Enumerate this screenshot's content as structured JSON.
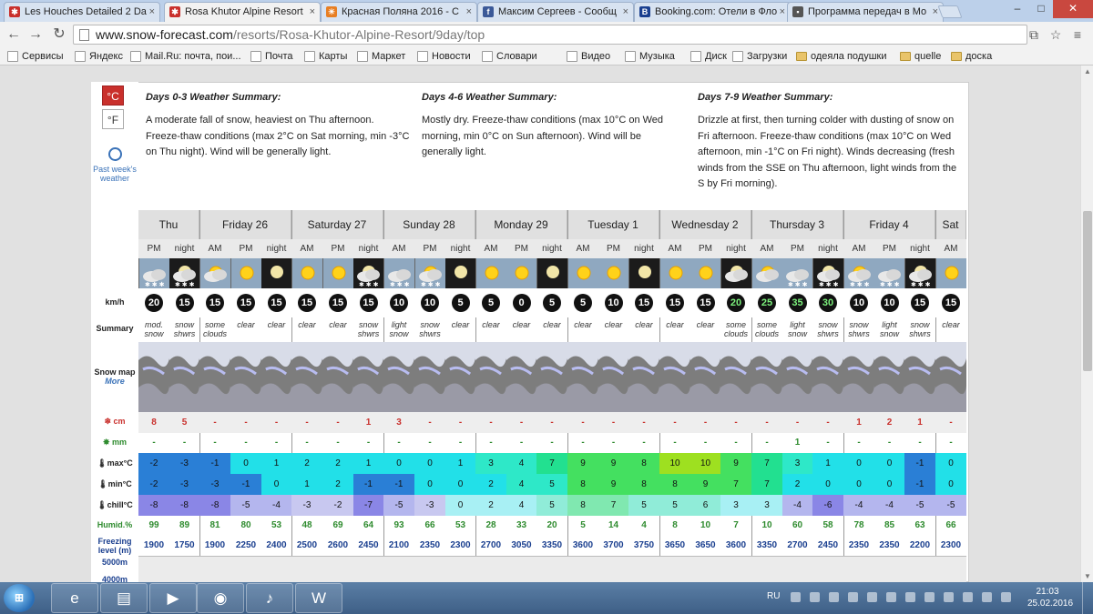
{
  "browser": {
    "tabs": [
      {
        "title": "Les Houches Detailed 2 Da",
        "fav_color": "#c9302c",
        "fav_glyph": "✱"
      },
      {
        "title": "Rosa Khutor Alpine Resort",
        "fav_color": "#c9302c",
        "fav_glyph": "✱"
      },
      {
        "title": "Красная Поляна 2016 - С",
        "fav_color": "#e87e22",
        "fav_glyph": "☀"
      },
      {
        "title": "Максим Сергеев - Сообщ",
        "fav_color": "#3b5998",
        "fav_glyph": "f"
      },
      {
        "title": "Booking.com: Отели в Фло",
        "fav_color": "#1a3f8f",
        "fav_glyph": "B"
      },
      {
        "title": "Программа передач в Мо",
        "fav_color": "#555555",
        "fav_glyph": "▪"
      }
    ],
    "url_host": "www.snow-forecast.com",
    "url_path": "/resorts/Rosa-Khutor-Alpine-Resort/9day/top",
    "bookmarks": [
      {
        "label": "Сервисы",
        "icon": "apps-icon"
      },
      {
        "label": "Яндекс",
        "icon": "page-icon"
      },
      {
        "label": "Mail.Ru: почта, пои...",
        "icon": "mail-icon"
      },
      {
        "label": "Почта",
        "icon": "mail-icon"
      },
      {
        "label": "Карты",
        "icon": "page-icon"
      },
      {
        "label": "Маркет",
        "icon": "page-icon"
      },
      {
        "label": "Новости",
        "icon": "page-icon"
      },
      {
        "label": "Словари",
        "icon": "page-icon"
      },
      {
        "label": "Видео",
        "icon": "page-icon"
      },
      {
        "label": "Музыка",
        "icon": "page-icon"
      },
      {
        "label": "Диск",
        "icon": "page-icon"
      },
      {
        "label": "Загрузки",
        "icon": "download-icon"
      },
      {
        "label": "одеяла подушки",
        "icon": "folder-icon"
      },
      {
        "label": "quelle",
        "icon": "folder-icon"
      },
      {
        "label": "доска",
        "icon": "folder-icon"
      }
    ]
  },
  "units": {
    "celsius": "°C",
    "fahrenheit": "°F"
  },
  "past_weather": "Past week's weather",
  "summaries": [
    {
      "title": "Days 0-3 Weather Summary:",
      "text": "A moderate fall of snow, heaviest on Thu afternoon. Freeze-thaw conditions (max 2°C on Sat morning, min -3°C on Thu night). Wind will be generally light."
    },
    {
      "title": "Days 4-6 Weather Summary:",
      "text": "Mostly dry. Freeze-thaw conditions (max 10°C on Wed morning, min 0°C on Sun afternoon). Wind will be generally light."
    },
    {
      "title": "Days 7-9 Weather Summary:",
      "text": "Drizzle at first, then turning colder with dusting of snow on Fri afternoon. Freeze-thaw conditions (max 10°C on Wed afternoon, min -1°C on Fri night). Winds decreasing (fresh winds from the SSE on Thu afternoon, light winds from the S by Fri morning)."
    }
  ],
  "row_labels": {
    "wind": "km/h",
    "summary": "Summary",
    "snowmap": "Snow map",
    "snowmap_more": "More",
    "snow": "cm",
    "rain": "mm",
    "max": "max°C",
    "min": "min°C",
    "chill": "chill°C",
    "humid": "Humid.%",
    "freezing": "Freezing level (m)",
    "level1": "5000m",
    "level2": "4000m"
  },
  "days": [
    {
      "name": "Thu",
      "span": 2
    },
    {
      "name": "Friday 26",
      "span": 3
    },
    {
      "name": "Saturday 27",
      "span": 3
    },
    {
      "name": "Sunday 28",
      "span": 3
    },
    {
      "name": "Monday 29",
      "span": 3
    },
    {
      "name": "Tuesday 1",
      "span": 3
    },
    {
      "name": "Wednesday 2",
      "span": 3
    },
    {
      "name": "Thursday 3",
      "span": 3
    },
    {
      "name": "Friday 4",
      "span": 3
    },
    {
      "name": "Sat",
      "span": 1
    }
  ],
  "periods": [
    {
      "tod": "PM",
      "icon": "snow",
      "wind": "20",
      "wind_green": false,
      "summary": "mod. snow",
      "snow": "8",
      "rain": "-",
      "max": "-2",
      "min": "-2",
      "chill": "-8",
      "humid": "99",
      "frz": "1900",
      "cmax": "#2a7fd6",
      "cmin": "#2a7fd6",
      "cchill": "#8a86e6"
    },
    {
      "tod": "night",
      "icon": "night-snow",
      "wind": "15",
      "wind_green": false,
      "summary": "snow shwrs",
      "snow": "5",
      "rain": "-",
      "max": "-3",
      "min": "-3",
      "chill": "-8",
      "humid": "89",
      "frz": "1750",
      "cmax": "#2a7fd6",
      "cmin": "#2a7fd6",
      "cchill": "#8a86e6"
    },
    {
      "tod": "AM",
      "icon": "sun-cloud",
      "wind": "15",
      "wind_green": false,
      "summary": "some clouds",
      "snow": "-",
      "rain": "-",
      "max": "-1",
      "min": "-3",
      "chill": "-8",
      "humid": "81",
      "frz": "1900",
      "cmax": "#2a7fd6",
      "cmin": "#2a7fd6",
      "cchill": "#8a86e6"
    },
    {
      "tod": "PM",
      "icon": "sun",
      "wind": "15",
      "wind_green": false,
      "summary": "clear",
      "snow": "-",
      "rain": "-",
      "max": "0",
      "min": "-1",
      "chill": "-5",
      "humid": "80",
      "frz": "2250",
      "cmax": "#22e0e8",
      "cmin": "#2a7fd6",
      "cchill": "#b4b6ee"
    },
    {
      "tod": "night",
      "icon": "moon",
      "wind": "15",
      "wind_green": false,
      "summary": "clear",
      "snow": "-",
      "rain": "-",
      "max": "1",
      "min": "0",
      "chill": "-4",
      "humid": "53",
      "frz": "2400",
      "cmax": "#22e0e8",
      "cmin": "#22e0e8",
      "cchill": "#b4b6ee"
    },
    {
      "tod": "AM",
      "icon": "sun",
      "wind": "15",
      "wind_green": false,
      "summary": "clear",
      "snow": "-",
      "rain": "-",
      "max": "2",
      "min": "1",
      "chill": "-3",
      "humid": "48",
      "frz": "2500",
      "cmax": "#22e0e8",
      "cmin": "#22e0e8",
      "cchill": "#c8c8f0"
    },
    {
      "tod": "PM",
      "icon": "sun",
      "wind": "15",
      "wind_green": false,
      "summary": "clear",
      "snow": "-",
      "rain": "-",
      "max": "2",
      "min": "2",
      "chill": "-2",
      "humid": "69",
      "frz": "2600",
      "cmax": "#22e0e8",
      "cmin": "#22e0e8",
      "cchill": "#c8c8f0"
    },
    {
      "tod": "night",
      "icon": "night-snow",
      "wind": "15",
      "wind_green": false,
      "summary": "snow shwrs",
      "snow": "1",
      "rain": "-",
      "max": "1",
      "min": "-1",
      "chill": "-7",
      "humid": "64",
      "frz": "2450",
      "cmax": "#22e0e8",
      "cmin": "#2a7fd6",
      "cchill": "#8a86e6"
    },
    {
      "tod": "AM",
      "icon": "snow",
      "wind": "10",
      "wind_green": false,
      "summary": "light snow",
      "snow": "3",
      "rain": "-",
      "max": "0",
      "min": "-1",
      "chill": "-5",
      "humid": "93",
      "frz": "2100",
      "cmax": "#22e0e8",
      "cmin": "#2a7fd6",
      "cchill": "#b4b6ee"
    },
    {
      "tod": "PM",
      "icon": "sun-snow",
      "wind": "10",
      "wind_green": false,
      "summary": "snow shwrs",
      "snow": "-",
      "rain": "-",
      "max": "0",
      "min": "0",
      "chill": "-3",
      "humid": "66",
      "frz": "2350",
      "cmax": "#22e0e8",
      "cmin": "#22e0e8",
      "cchill": "#c8c8f0"
    },
    {
      "tod": "night",
      "icon": "moon",
      "wind": "5",
      "wind_green": false,
      "summary": "clear",
      "snow": "-",
      "rain": "-",
      "max": "1",
      "min": "0",
      "chill": "0",
      "humid": "53",
      "frz": "2300",
      "cmax": "#22e0e8",
      "cmin": "#22e0e8",
      "cchill": "#a8f0f4"
    },
    {
      "tod": "AM",
      "icon": "sun",
      "wind": "5",
      "wind_green": false,
      "summary": "clear",
      "snow": "-",
      "rain": "-",
      "max": "3",
      "min": "2",
      "chill": "2",
      "humid": "28",
      "frz": "2700",
      "cmax": "#2ee8c8",
      "cmin": "#22e0e8",
      "cchill": "#a8f0f4"
    },
    {
      "tod": "PM",
      "icon": "sun",
      "wind": "0",
      "wind_green": false,
      "summary": "clear",
      "snow": "-",
      "rain": "-",
      "max": "4",
      "min": "4",
      "chill": "4",
      "humid": "33",
      "frz": "3050",
      "cmax": "#2ee8c8",
      "cmin": "#2ee8c8",
      "cchill": "#a8f0f4"
    },
    {
      "tod": "night",
      "icon": "moon",
      "wind": "5",
      "wind_green": false,
      "summary": "clear",
      "snow": "-",
      "rain": "-",
      "max": "7",
      "min": "5",
      "chill": "5",
      "humid": "20",
      "frz": "3350",
      "cmax": "#22e090",
      "cmin": "#2ee8c8",
      "cchill": "#90ecd8"
    },
    {
      "tod": "AM",
      "icon": "sun",
      "wind": "5",
      "wind_green": false,
      "summary": "clear",
      "snow": "-",
      "rain": "-",
      "max": "9",
      "min": "8",
      "chill": "8",
      "humid": "5",
      "frz": "3600",
      "cmax": "#44e060",
      "cmin": "#44e060",
      "cchill": "#80e8b0"
    },
    {
      "tod": "PM",
      "icon": "sun",
      "wind": "10",
      "wind_green": false,
      "summary": "clear",
      "snow": "-",
      "rain": "-",
      "max": "9",
      "min": "9",
      "chill": "7",
      "humid": "14",
      "frz": "3700",
      "cmax": "#44e060",
      "cmin": "#44e060",
      "cchill": "#80e8b0"
    },
    {
      "tod": "night",
      "icon": "moon",
      "wind": "15",
      "wind_green": false,
      "summary": "clear",
      "snow": "-",
      "rain": "-",
      "max": "8",
      "min": "8",
      "chill": "5",
      "humid": "4",
      "frz": "3750",
      "cmax": "#44e060",
      "cmin": "#44e060",
      "cchill": "#90ecd8"
    },
    {
      "tod": "AM",
      "icon": "sun",
      "wind": "15",
      "wind_green": false,
      "summary": "clear",
      "snow": "-",
      "rain": "-",
      "max": "10",
      "min": "8",
      "chill": "5",
      "humid": "8",
      "frz": "3650",
      "cmax": "#9ee020",
      "cmin": "#44e060",
      "cchill": "#90ecd8"
    },
    {
      "tod": "PM",
      "icon": "sun",
      "wind": "15",
      "wind_green": false,
      "summary": "clear",
      "snow": "-",
      "rain": "-",
      "max": "10",
      "min": "9",
      "chill": "6",
      "humid": "10",
      "frz": "3650",
      "cmax": "#9ee020",
      "cmin": "#44e060",
      "cchill": "#90ecd8"
    },
    {
      "tod": "night",
      "icon": "night-cloud",
      "wind": "20",
      "wind_green": true,
      "summary": "some clouds",
      "snow": "-",
      "rain": "-",
      "max": "9",
      "min": "7",
      "chill": "3",
      "humid": "7",
      "frz": "3600",
      "cmax": "#44e060",
      "cmin": "#44e060",
      "cchill": "#a8f0f4"
    },
    {
      "tod": "AM",
      "icon": "sun-cloud",
      "wind": "25",
      "wind_green": true,
      "summary": "some clouds",
      "snow": "-",
      "rain": "-",
      "max": "7",
      "min": "7",
      "chill": "3",
      "humid": "10",
      "frz": "3350",
      "cmax": "#22e090",
      "cmin": "#22e090",
      "cchill": "#a8f0f4"
    },
    {
      "tod": "PM",
      "icon": "snow",
      "wind": "35",
      "wind_green": true,
      "summary": "light snow",
      "snow": "-",
      "rain": "1",
      "max": "3",
      "min": "2",
      "chill": "-4",
      "humid": "60",
      "frz": "2700",
      "cmax": "#2ee8c8",
      "cmin": "#22e0e8",
      "cchill": "#b4b6ee"
    },
    {
      "tod": "night",
      "icon": "night-snow",
      "wind": "30",
      "wind_green": true,
      "summary": "snow shwrs",
      "snow": "-",
      "rain": "-",
      "max": "1",
      "min": "0",
      "chill": "-6",
      "humid": "58",
      "frz": "2450",
      "cmax": "#22e0e8",
      "cmin": "#22e0e8",
      "cchill": "#8a86e6"
    },
    {
      "tod": "AM",
      "icon": "sun-snow",
      "wind": "10",
      "wind_green": false,
      "summary": "snow shwrs",
      "snow": "1",
      "rain": "-",
      "max": "0",
      "min": "0",
      "chill": "-4",
      "humid": "78",
      "frz": "2350",
      "cmax": "#22e0e8",
      "cmin": "#22e0e8",
      "cchill": "#b4b6ee"
    },
    {
      "tod": "PM",
      "icon": "snow",
      "wind": "10",
      "wind_green": false,
      "summary": "light snow",
      "snow": "2",
      "rain": "-",
      "max": "0",
      "min": "0",
      "chill": "-4",
      "humid": "85",
      "frz": "2350",
      "cmax": "#22e0e8",
      "cmin": "#22e0e8",
      "cchill": "#b4b6ee"
    },
    {
      "tod": "night",
      "icon": "night-snow",
      "wind": "15",
      "wind_green": false,
      "summary": "snow shwrs",
      "snow": "1",
      "rain": "-",
      "max": "-1",
      "min": "-1",
      "chill": "-5",
      "humid": "63",
      "frz": "2200",
      "cmax": "#2a7fd6",
      "cmin": "#2a7fd6",
      "cchill": "#b4b6ee"
    },
    {
      "tod": "AM",
      "icon": "sun",
      "wind": "15",
      "wind_green": false,
      "summary": "clear",
      "snow": "-",
      "rain": "-",
      "max": "0",
      "min": "0",
      "chill": "-5",
      "humid": "66",
      "frz": "2300",
      "cmax": "#22e0e8",
      "cmin": "#22e0e8",
      "cchill": "#b4b6ee"
    }
  ],
  "taskbar": {
    "apps": [
      "ie-icon",
      "explorer-icon",
      "media-player-icon",
      "chrome-icon",
      "audio-icon",
      "word-icon"
    ],
    "lang": "RU",
    "time": "21:03",
    "date": "25.02.2016"
  }
}
